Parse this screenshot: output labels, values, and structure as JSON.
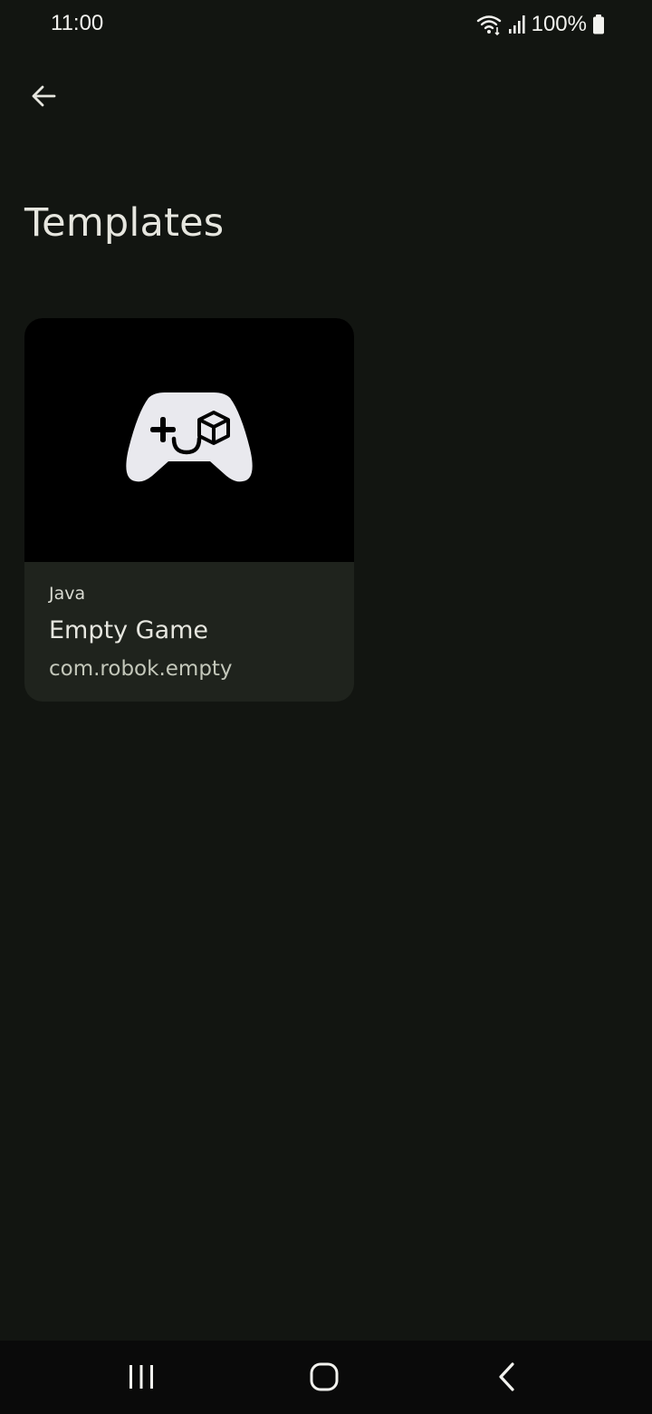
{
  "status_bar": {
    "time": "11:00",
    "battery": "100%",
    "icons": [
      "wifi-icon",
      "signal-icon",
      "battery-icon"
    ]
  },
  "toolbar": {
    "back_icon": "arrow-back-icon"
  },
  "page": {
    "title": "Templates"
  },
  "templates": [
    {
      "icon": "gamepad-icon",
      "language": "Java",
      "name": "Empty Game",
      "package": "com.robok.empty"
    }
  ],
  "nav_bar": {
    "icons": [
      "recent-apps-icon",
      "home-icon",
      "back-icon"
    ]
  },
  "colors": {
    "background": "#121511",
    "card_background": "#1f231d",
    "card_image_background": "#000000",
    "text_primary": "#e6e6df",
    "text_secondary": "#c3c7ba"
  }
}
